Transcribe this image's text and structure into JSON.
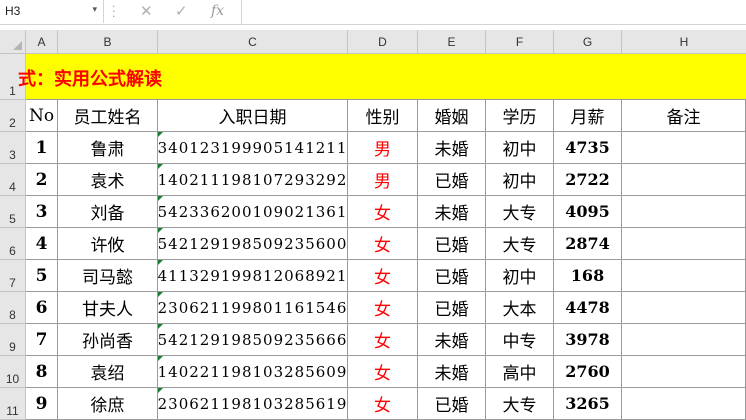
{
  "formula_bar": {
    "name_box": "H3",
    "dropdown_glyph": "▾",
    "cancel_glyph": "✕",
    "confirm_glyph": "✓",
    "fx_label": "fx",
    "formula": ""
  },
  "columns": [
    "A",
    "B",
    "C",
    "D",
    "E",
    "F",
    "G",
    "H"
  ],
  "rows": [
    "1",
    "2",
    "3",
    "4",
    "5",
    "6",
    "7",
    "8",
    "9",
    "10",
    "11"
  ],
  "sheet": {
    "title": "式：实用公式解读",
    "headers": [
      "No",
      "员工姓名",
      "入职日期",
      "性别",
      "婚姻",
      "学历",
      "月薪",
      "备注"
    ],
    "records": [
      {
        "no": "1",
        "name": "鲁肃",
        "id": "340123199905141211",
        "sex": "男",
        "marital": "未婚",
        "edu": "初中",
        "salary": "4735",
        "note": ""
      },
      {
        "no": "2",
        "name": "袁术",
        "id": "140211198107293292",
        "sex": "男",
        "marital": "已婚",
        "edu": "初中",
        "salary": "2722",
        "note": ""
      },
      {
        "no": "3",
        "name": "刘备",
        "id": "542336200109021361",
        "sex": "女",
        "marital": "未婚",
        "edu": "大专",
        "salary": "4095",
        "note": ""
      },
      {
        "no": "4",
        "name": "许攸",
        "id": "542129198509235600",
        "sex": "女",
        "marital": "已婚",
        "edu": "大专",
        "salary": "2874",
        "note": ""
      },
      {
        "no": "5",
        "name": "司马懿",
        "id": "411329199812068921",
        "sex": "女",
        "marital": "已婚",
        "edu": "初中",
        "salary": "168",
        "note": ""
      },
      {
        "no": "6",
        "name": "甘夫人",
        "id": "230621199801161546",
        "sex": "女",
        "marital": "已婚",
        "edu": "大本",
        "salary": "4478",
        "note": ""
      },
      {
        "no": "7",
        "name": "孙尚香",
        "id": "542129198509235666",
        "sex": "女",
        "marital": "未婚",
        "edu": "中专",
        "salary": "3978",
        "note": ""
      },
      {
        "no": "8",
        "name": "袁绍",
        "id": "140221198103285609",
        "sex": "女",
        "marital": "未婚",
        "edu": "高中",
        "salary": "2760",
        "note": ""
      },
      {
        "no": "9",
        "name": "徐庶",
        "id": "230621198103285619",
        "sex": "女",
        "marital": "已婚",
        "edu": "大专",
        "salary": "3265",
        "note": ""
      }
    ]
  },
  "colors": {
    "title_fill": "#ffff00",
    "title_text": "#ff0000",
    "female_male_text": "#ff0000",
    "header_bg": "#e6e6e6",
    "text_flag": "#1d7d2f"
  }
}
